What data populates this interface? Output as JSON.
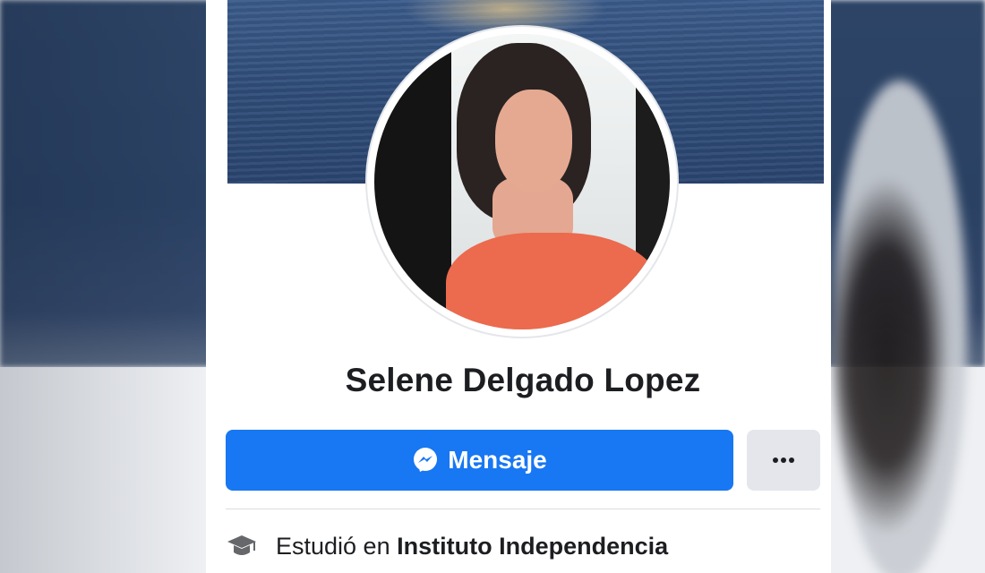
{
  "profile": {
    "name": "Selene Delgado Lopez",
    "message_button_label": "Mensaje",
    "more_button_label": "•••",
    "education_prefix": "Estudió en",
    "education_school": "Instituto Independencia"
  },
  "icons": {
    "message": "messenger-icon",
    "more": "more-options-icon",
    "education": "graduation-cap-icon"
  },
  "colors": {
    "primary_button": "#1877f2",
    "secondary_button": "#e4e6eb",
    "name_text": "#1c1e21"
  }
}
